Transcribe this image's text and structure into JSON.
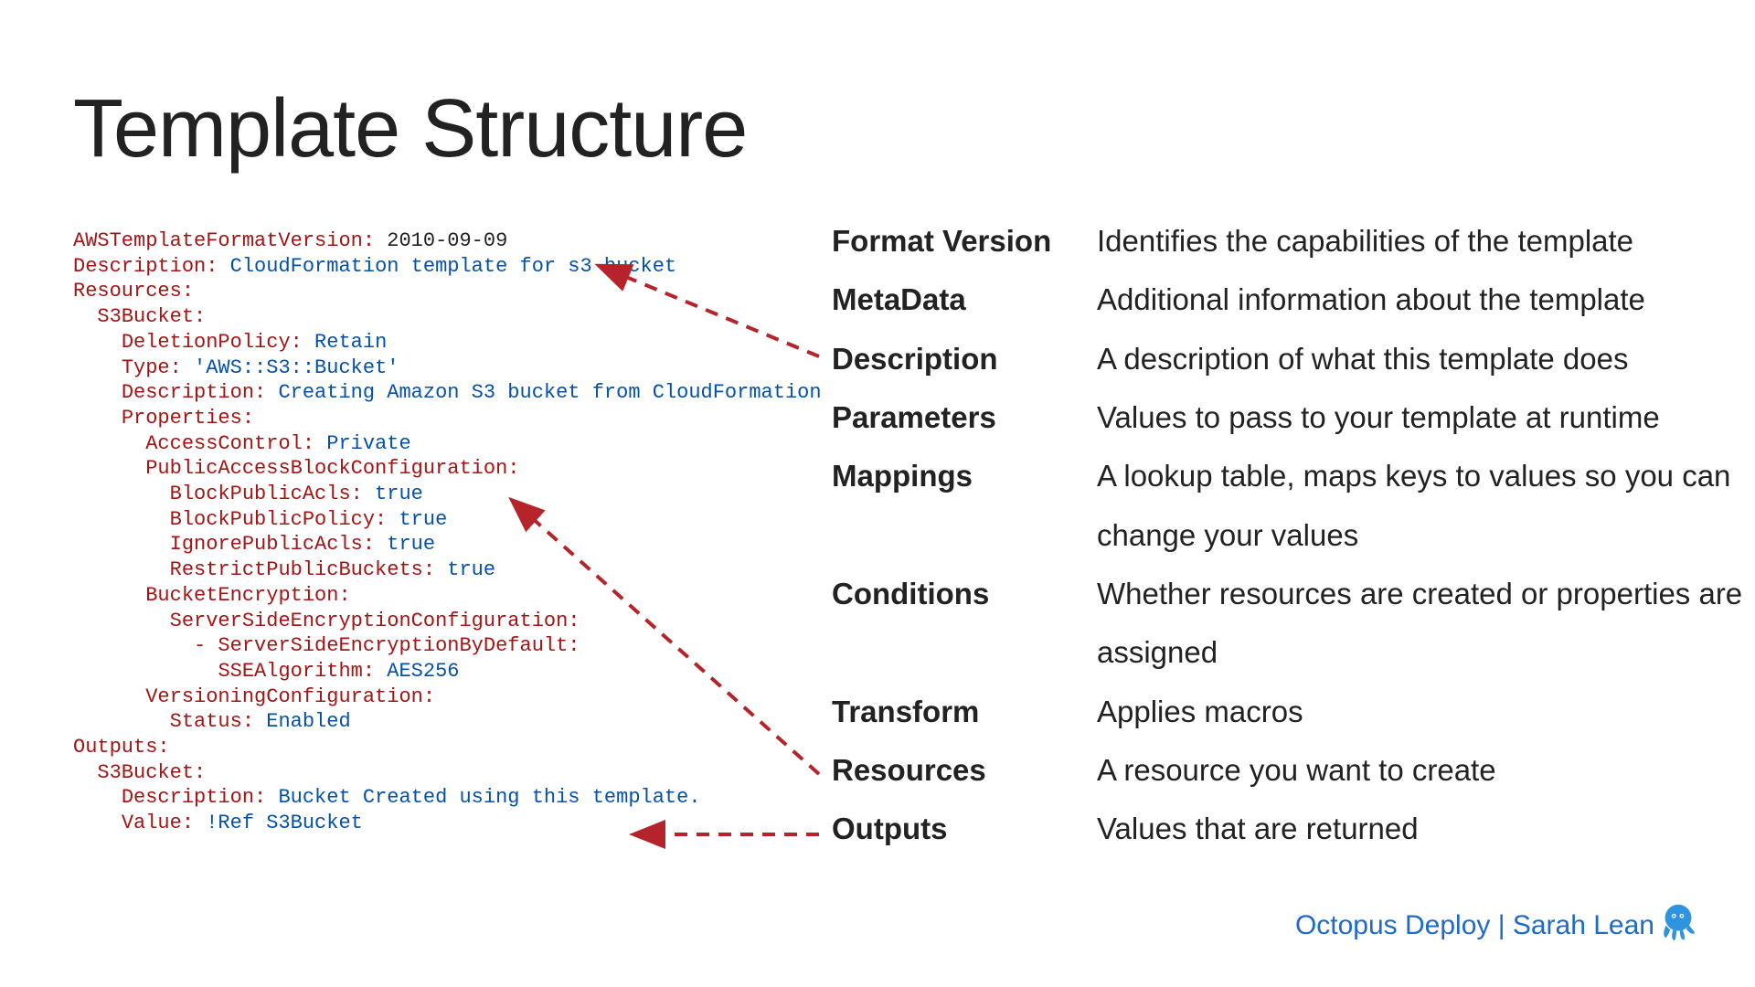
{
  "title": "Template Structure",
  "code": {
    "lines": [
      {
        "indent": 0,
        "key": "AWSTemplateFormatVersion:",
        "value": " 2010-09-09",
        "valueClass": "kv-plain"
      },
      {
        "indent": 0,
        "key": "Description:",
        "value": " CloudFormation template for s3 bucket"
      },
      {
        "indent": 0,
        "key": "Resources:",
        "value": ""
      },
      {
        "indent": 1,
        "key": "S3Bucket:",
        "value": ""
      },
      {
        "indent": 2,
        "key": "DeletionPolicy:",
        "value": " Retain"
      },
      {
        "indent": 2,
        "key": "Type:",
        "value": " 'AWS::S3::Bucket'"
      },
      {
        "indent": 2,
        "key": "Description:",
        "value": " Creating Amazon S3 bucket from CloudFormation"
      },
      {
        "indent": 2,
        "key": "Properties:",
        "value": ""
      },
      {
        "indent": 3,
        "key": "AccessControl:",
        "value": " Private"
      },
      {
        "indent": 3,
        "key": "PublicAccessBlockConfiguration:",
        "value": ""
      },
      {
        "indent": 4,
        "key": "BlockPublicAcls:",
        "value": " true"
      },
      {
        "indent": 4,
        "key": "BlockPublicPolicy:",
        "value": " true"
      },
      {
        "indent": 4,
        "key": "IgnorePublicAcls:",
        "value": " true"
      },
      {
        "indent": 4,
        "key": "RestrictPublicBuckets:",
        "value": " true"
      },
      {
        "indent": 3,
        "key": "BucketEncryption:",
        "value": ""
      },
      {
        "indent": 4,
        "key": "ServerSideEncryptionConfiguration:",
        "value": ""
      },
      {
        "indent": 5,
        "key": "- ServerSideEncryptionByDefault:",
        "value": ""
      },
      {
        "indent": 6,
        "key": "SSEAlgorithm:",
        "value": " AES256"
      },
      {
        "indent": 3,
        "key": "VersioningConfiguration:",
        "value": ""
      },
      {
        "indent": 4,
        "key": "Status:",
        "value": " Enabled"
      },
      {
        "indent": 0,
        "key": "Outputs:",
        "value": ""
      },
      {
        "indent": 1,
        "key": "S3Bucket:",
        "value": ""
      },
      {
        "indent": 2,
        "key": "Description:",
        "value": " Bucket Created using this template."
      },
      {
        "indent": 2,
        "key": "Value:",
        "value": " !Ref S3Bucket",
        "valueClass": "kv-ref"
      }
    ]
  },
  "definitions": [
    {
      "term": "Format Version",
      "desc": "Identifies the capabilities of the template"
    },
    {
      "term": "MetaData",
      "desc": "Additional information about the template"
    },
    {
      "term": "Description",
      "desc": "A description of what this template does"
    },
    {
      "term": "Parameters",
      "desc": "Values to pass to your template at runtime"
    },
    {
      "term": "Mappings",
      "desc": "A lookup table, maps keys to values so you can change your values"
    },
    {
      "term": "Conditions",
      "desc": "Whether resources are created or properties are assigned"
    },
    {
      "term": "Transform",
      "desc": "Applies macros"
    },
    {
      "term": "Resources",
      "desc": "A resource you want to create"
    },
    {
      "term": "Outputs",
      "desc": "Values that are returned"
    }
  ],
  "footer": {
    "text": "Octopus Deploy | Sarah Lean"
  },
  "colors": {
    "arrow": "#B4242A",
    "brand": "#1E6AC6"
  }
}
